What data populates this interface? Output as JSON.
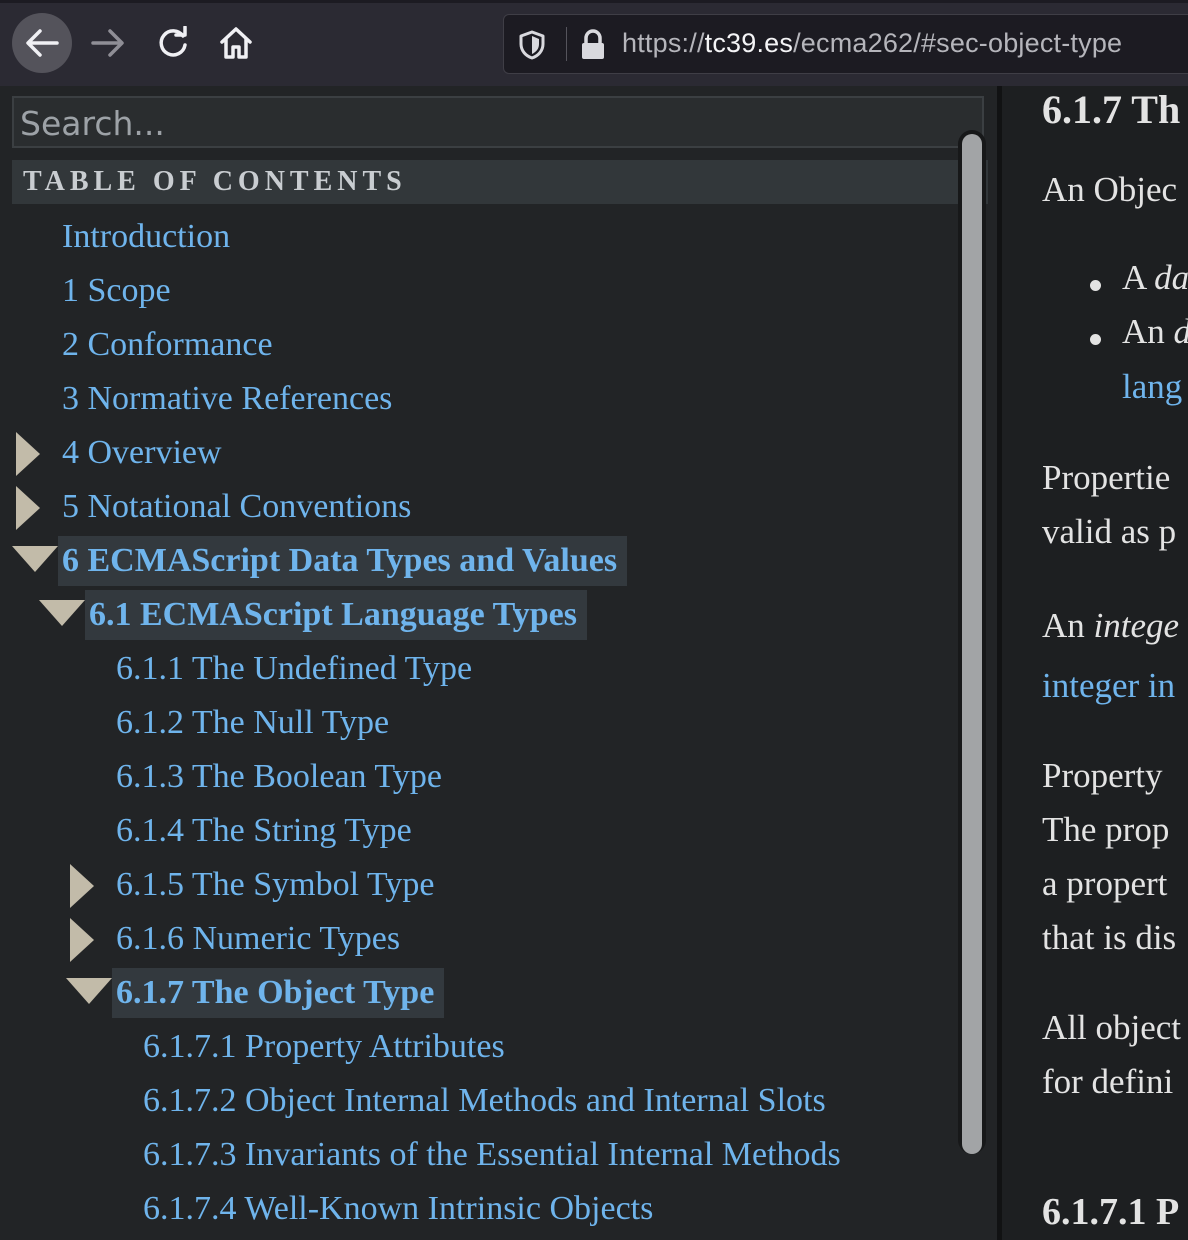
{
  "browser": {
    "url_scheme": "https://",
    "url_host": "tc39.es",
    "url_path": "/ecma262/#sec-object-type"
  },
  "sidebar": {
    "search_placeholder": "Search...",
    "toc_title": "TABLE OF CONTENTS",
    "items": [
      {
        "label": "Introduction",
        "twisty": "none",
        "active": false
      },
      {
        "label": "1 Scope",
        "twisty": "none",
        "active": false
      },
      {
        "label": "2 Conformance",
        "twisty": "none",
        "active": false
      },
      {
        "label": "3 Normative References",
        "twisty": "none",
        "active": false
      },
      {
        "label": "4 Overview",
        "twisty": "collapsed",
        "active": false
      },
      {
        "label": "5 Notational Conventions",
        "twisty": "collapsed",
        "active": false
      },
      {
        "label": "6 ECMAScript Data Types and Values",
        "twisty": "expanded",
        "active": true
      },
      {
        "label": "6.1 ECMAScript Language Types",
        "twisty": "expanded",
        "active": true
      },
      {
        "label": "6.1.1 The Undefined Type",
        "twisty": "none",
        "active": false
      },
      {
        "label": "6.1.2 The Null Type",
        "twisty": "none",
        "active": false
      },
      {
        "label": "6.1.3 The Boolean Type",
        "twisty": "none",
        "active": false
      },
      {
        "label": "6.1.4 The String Type",
        "twisty": "none",
        "active": false
      },
      {
        "label": "6.1.5 The Symbol Type",
        "twisty": "collapsed",
        "active": false
      },
      {
        "label": "6.1.6 Numeric Types",
        "twisty": "collapsed",
        "active": false
      },
      {
        "label": "6.1.7 The Object Type",
        "twisty": "expanded",
        "active": true
      },
      {
        "label": "6.1.7.1 Property Attributes",
        "twisty": "none",
        "active": false
      },
      {
        "label": "6.1.7.2 Object Internal Methods and Internal Slots",
        "twisty": "none",
        "active": false
      },
      {
        "label": "6.1.7.3 Invariants of the Essential Internal Methods",
        "twisty": "none",
        "active": false
      },
      {
        "label": "6.1.7.4 Well-Known Intrinsic Objects",
        "twisty": "none",
        "active": false
      }
    ]
  },
  "content": {
    "heading": "6.1.7  Th",
    "p1": "An Objec",
    "li1": "A ",
    "li1_em": "da",
    "li2": "An ",
    "li2_em": "d",
    "li2_link": "lang",
    "p2a": "Propertie",
    "p2b": "valid as p",
    "p3a": "An ",
    "p3a_em": "intege",
    "p3b_link": "integer in",
    "p4a": "Property",
    "p4b": "The prop",
    "p4c": "a propert",
    "p4d": "that is dis",
    "p5a": "All object",
    "p5b": "for defini",
    "subheading": "6.1.7.1  P"
  }
}
